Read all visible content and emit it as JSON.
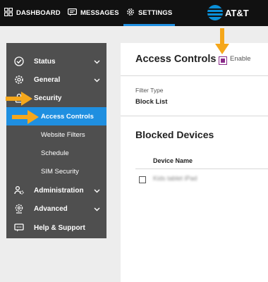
{
  "topnav": {
    "dashboard": "DASHBOARD",
    "messages": "MESSAGES",
    "settings": "SETTINGS",
    "brand": "AT&T"
  },
  "sidebar": {
    "items": [
      {
        "label": "Status",
        "icon": "check-circle-icon",
        "chevron": true
      },
      {
        "label": "General",
        "icon": "gear-icon",
        "chevron": true
      },
      {
        "label": "Security",
        "icon": "lock-icon",
        "chevron": false
      },
      {
        "label": "Access Controls",
        "active": true
      },
      {
        "label": "Website Filters"
      },
      {
        "label": "Schedule"
      },
      {
        "label": "SIM Security"
      },
      {
        "label": "Administration",
        "icon": "users-gear-icon",
        "chevron": true
      },
      {
        "label": "Advanced",
        "icon": "advanced-gear-icon",
        "chevron": true
      },
      {
        "label": "Help & Support",
        "icon": "chat-bubble-icon",
        "chevron": false
      }
    ]
  },
  "access_controls": {
    "title": "Access Controls",
    "enable_label": "Enable",
    "enabled": true,
    "filter_type_label": "Filter Type",
    "filter_type_value": "Block List"
  },
  "blocked_devices": {
    "title": "Blocked Devices",
    "column_header": "Device Name",
    "rows": [
      {
        "name": "Kids tablet iPad"
      }
    ]
  },
  "colors": {
    "topbar": "#111111",
    "accent": "#1f8fe0",
    "sidebar": "#4f4f4f",
    "checkbox": "#8a2b8a",
    "annotation_arrow": "#f5a71b"
  }
}
